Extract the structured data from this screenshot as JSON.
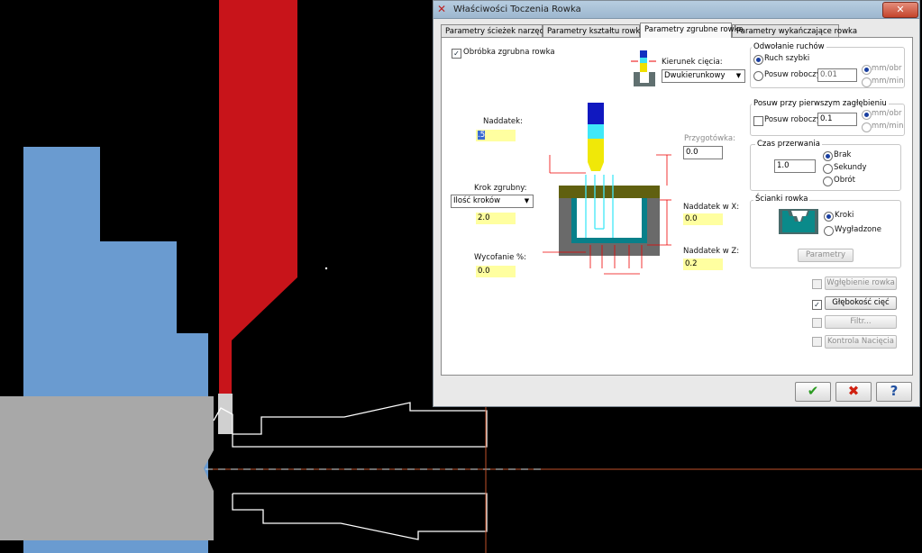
{
  "dialog": {
    "title": "Właściwości Toczenia Rowka",
    "close_glyph": "✕",
    "tabs": [
      {
        "label": "Parametry ścieżek narzędzia"
      },
      {
        "label": "Parametry kształtu rowka"
      },
      {
        "label": "Parametry zgrubne rowka"
      },
      {
        "label": "Parametry wykańczające rowka"
      }
    ],
    "active_tab": 2,
    "rough_groove_checkbox": "Obróbka zgrubna rowka",
    "cut_direction": {
      "label": "Kierunek cięcia:",
      "value": "Dwukierunkowy"
    },
    "stock_allowance": {
      "label": "Naddatek:",
      "value": ".5"
    },
    "step": {
      "label": "Krok zgrubny:",
      "mode": "Ilość kroków",
      "value": "2.0"
    },
    "retract_pct": {
      "label": "Wycofanie %:",
      "value": "0.0"
    },
    "prep": {
      "label": "Przygotówka:",
      "value": "0.0"
    },
    "stock_x": {
      "label": "Naddatek w X:",
      "value": "0.0"
    },
    "stock_z": {
      "label": "Naddatek w Z:",
      "value": "0.2"
    },
    "retraction": {
      "title": "Odwołanie ruchów",
      "rapid": "Ruch szybki",
      "feed": "Posuw roboczy",
      "feed_value": "0.01",
      "unit1": "mm/obr",
      "unit2": "mm/min"
    },
    "first_plunge": {
      "title": "Posuw przy pierwszym zagłębieniu",
      "feed": "Posuw roboczy:",
      "feed_value": "0.1",
      "unit1": "mm/obr",
      "unit2": "mm/min"
    },
    "dwell": {
      "title": "Czas przerwania",
      "value": "1.0",
      "opt1": "Brak",
      "opt2": "Sekundy",
      "opt3": "Obrót"
    },
    "walls": {
      "title": "Ścianki rowka",
      "opt1": "Kroki",
      "opt2": "Wygładzone",
      "params_btn": "Parametry"
    },
    "side_buttons": [
      {
        "label": "Wgłębienie rowka",
        "checked": false
      },
      {
        "label": "Głębokość cięć",
        "checked": true
      },
      {
        "label": "Filtr...",
        "checked": false
      },
      {
        "label": "Kontrola Nacięcia",
        "checked": false
      }
    ],
    "ok_glyph": "✔",
    "cancel_glyph": "✖",
    "help_glyph": "?"
  },
  "colors": {
    "part": "#6a9bd0",
    "stock": "#a8a8a8",
    "tool": "#c8141a",
    "centerline": "#c0502a"
  }
}
